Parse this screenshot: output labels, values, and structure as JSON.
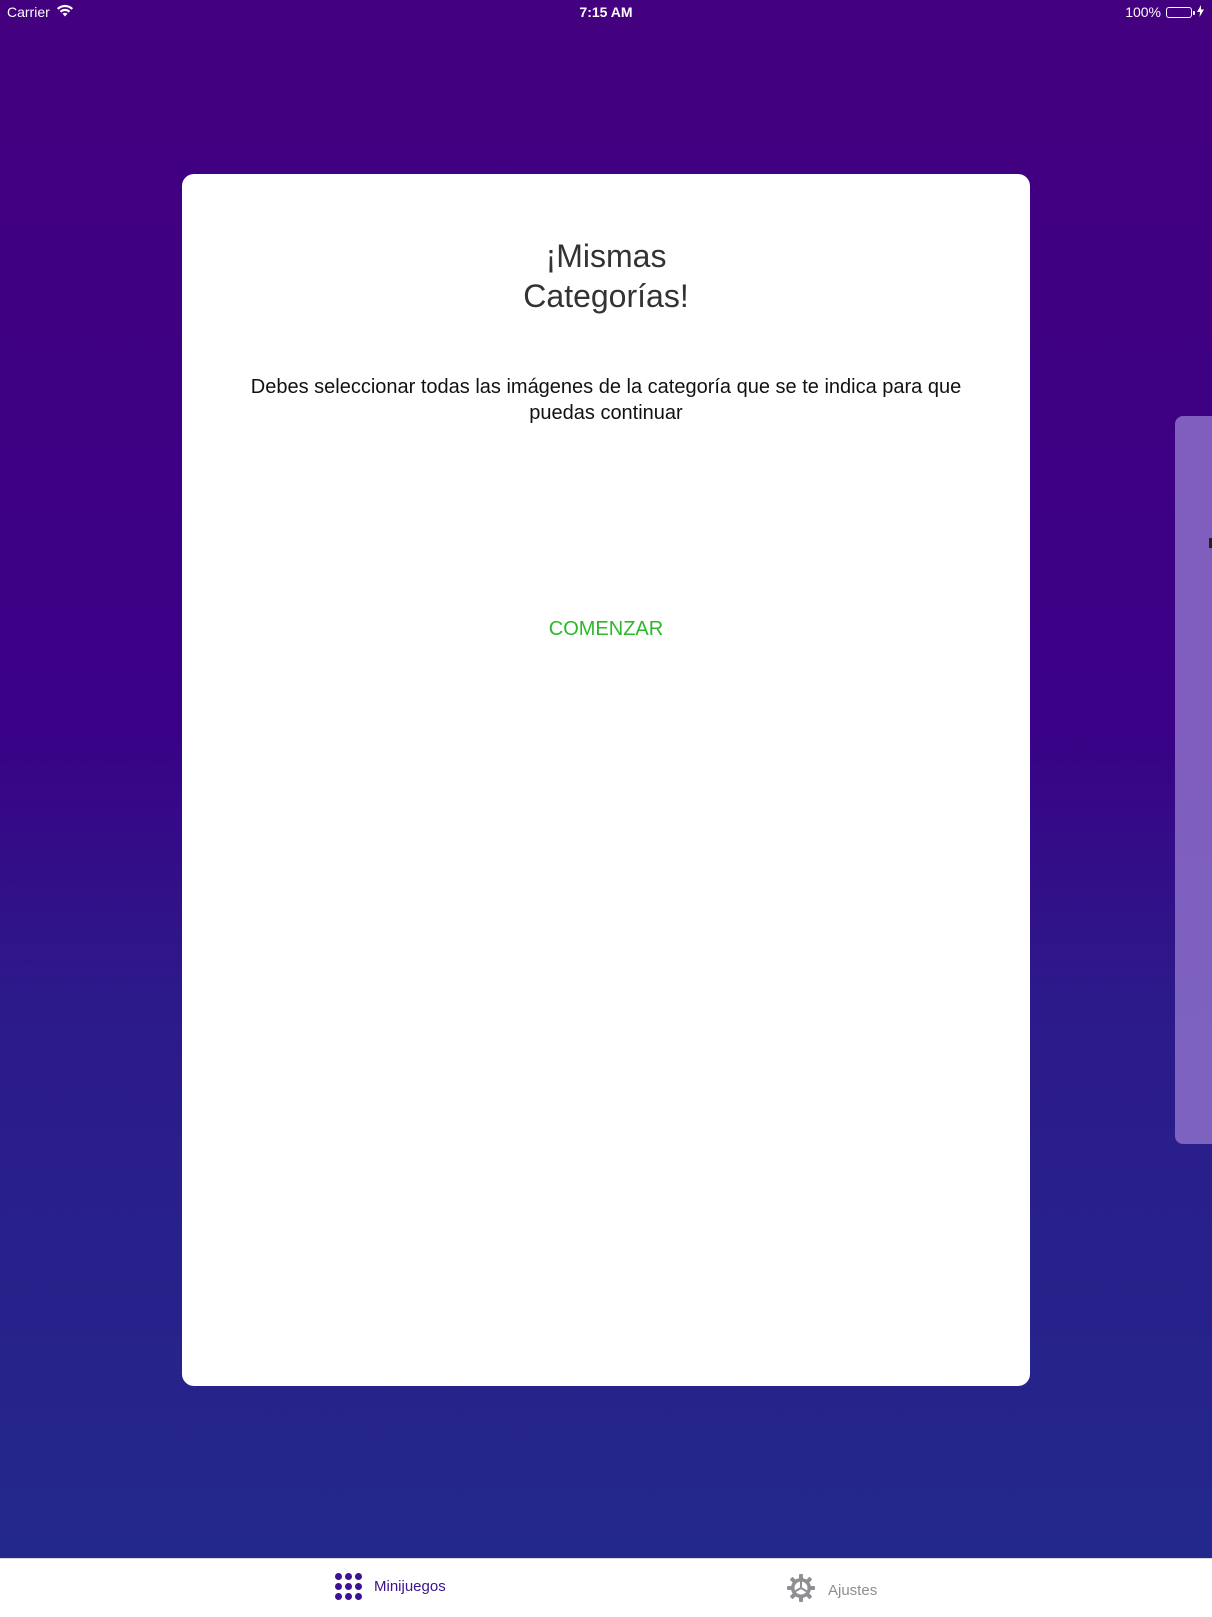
{
  "status_bar": {
    "carrier": "Carrier",
    "time": "7:15 AM",
    "battery_percent": "100%",
    "battery_level": 1.0
  },
  "card": {
    "title_line1": "¡Mismas",
    "title_line2": "Categorías!",
    "description": "Debes seleccionar todas las imágenes de la categoría que se te indica para que puedas continuar",
    "start_label": "COMENZAR"
  },
  "tab_bar": {
    "tabs": [
      {
        "label": "Minijuegos",
        "icon": "grid-dots-icon",
        "selected": true
      },
      {
        "label": "Ajustes",
        "icon": "gear-icon",
        "selected": false
      }
    ]
  },
  "colors": {
    "background_top": "#43007f",
    "background_bottom": "#222a8c",
    "accent": "#3b1290",
    "start_button": "#2db829",
    "inactive_tab": "#8e8e93"
  }
}
